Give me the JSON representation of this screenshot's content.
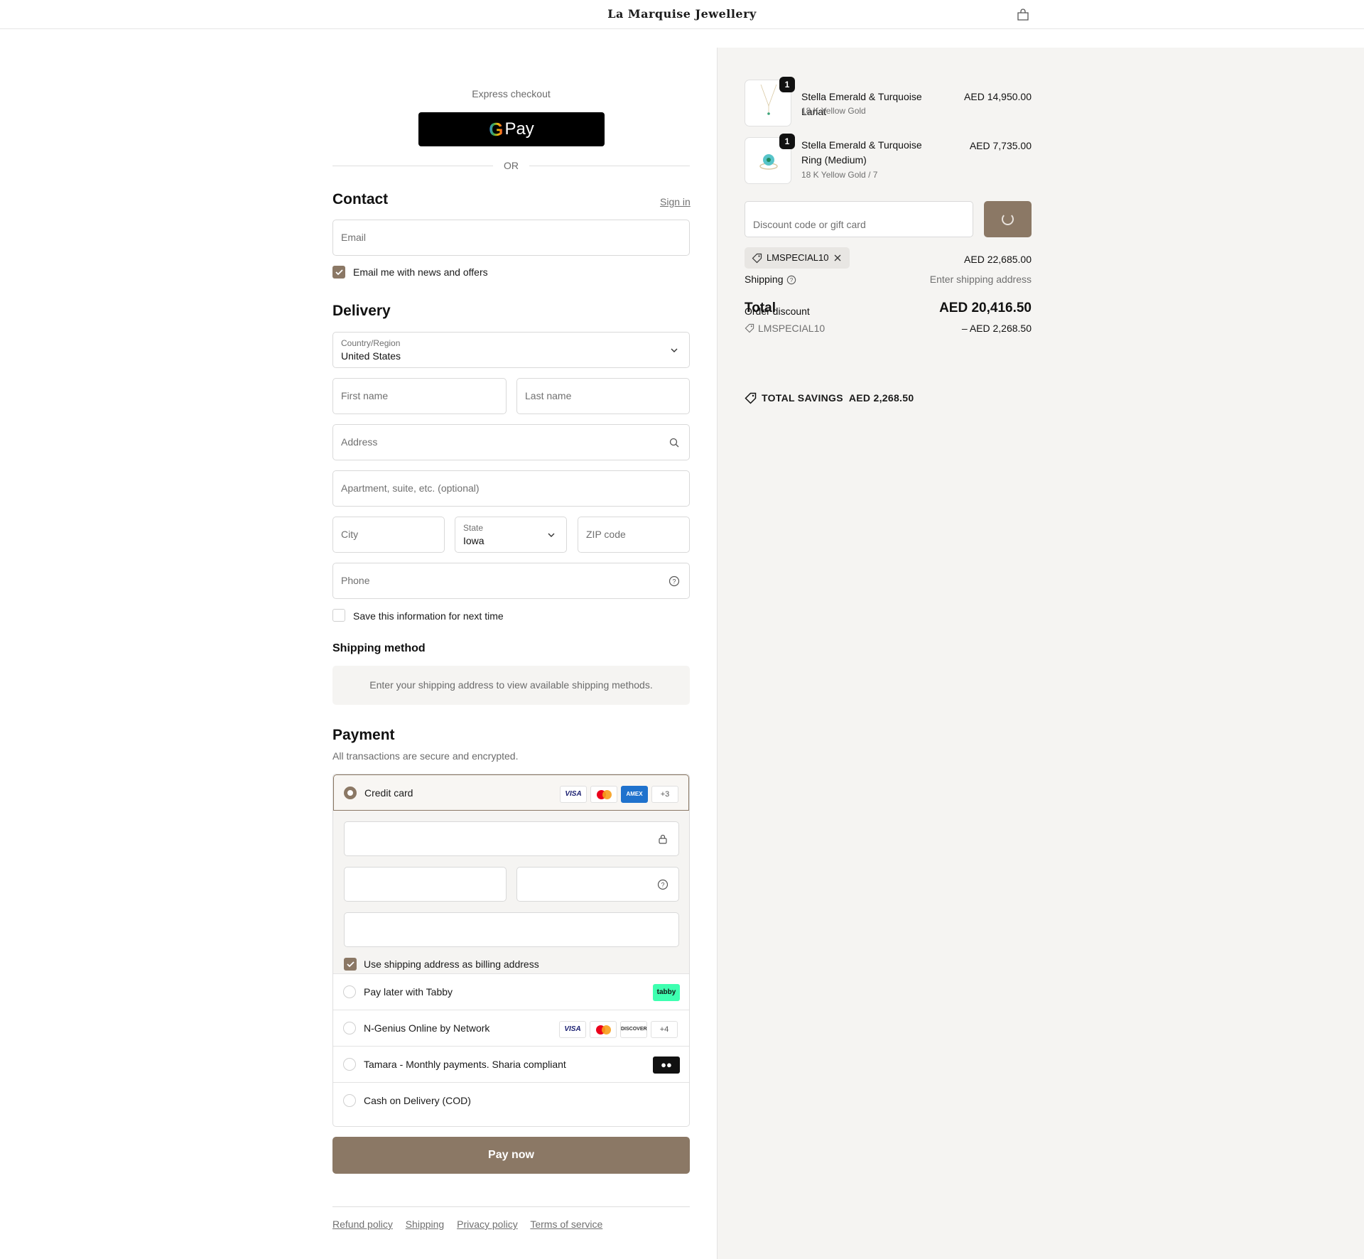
{
  "header": {
    "brand": "La Marquise Jewellery",
    "cart_icon": "shopping-bag-icon"
  },
  "express": {
    "label": "Express checkout",
    "gpay_label": "Pay",
    "or": "OR"
  },
  "contact": {
    "title": "Contact",
    "sign_in": "Sign in",
    "email_placeholder": "Email",
    "news_label": "Email me with news and offers",
    "news_checked": true
  },
  "delivery": {
    "title": "Delivery",
    "country_label": "Country/Region",
    "country_value": "United States",
    "first_name": "First name",
    "last_name": "Last name",
    "address": "Address",
    "apartment": "Apartment, suite, etc. (optional)",
    "city": "City",
    "state_label": "State",
    "state_value": "Iowa",
    "zip": "ZIP code",
    "phone": "Phone",
    "save_label": "Save this information for next time",
    "save_checked": false
  },
  "shipping_method": {
    "title": "Shipping method",
    "message": "Enter your shipping address to view available shipping methods."
  },
  "payment": {
    "title": "Payment",
    "subtitle": "All transactions are secure and encrypted.",
    "credit_card_label": "Credit card",
    "cc_logos": [
      "VISA",
      "AMEX",
      "+3"
    ],
    "billing_label": "Use shipping address as billing address",
    "billing_checked": true,
    "options": [
      {
        "label": "Pay later with Tabby",
        "badge": "tabby"
      },
      {
        "label": "N-Genius Online by Network",
        "logos": [
          "VISA",
          "DISCOVER",
          "+4"
        ]
      },
      {
        "label": "Tamara - Monthly payments. Sharia compliant"
      },
      {
        "label": "Cash on Delivery (COD)"
      }
    ],
    "pay_now": "Pay now"
  },
  "footer": {
    "links": [
      "Refund policy",
      "Shipping",
      "Privacy policy",
      "Terms of service"
    ]
  },
  "summary": {
    "items": [
      {
        "qty": "1",
        "name": "Stella Emerald & Turquoise Lariat",
        "variant": "18 K Yellow Gold",
        "price": "AED 14,950.00"
      },
      {
        "qty": "1",
        "name": "Stella Emerald & Turquoise Ring (Medium)",
        "variant": "18 K Yellow Gold / 7",
        "price": "AED 7,735.00"
      }
    ],
    "discount_placeholder": "Discount code or gift card",
    "applied_code": "LMSPECIAL10",
    "subtotal": "AED 22,685.00",
    "shipping_label": "Shipping",
    "shipping_value": "Enter shipping address",
    "total_label": "Total",
    "total_value": "AED 20,416.50",
    "order_discount_label": "Order discount",
    "order_discount_code": "LMSPECIAL10",
    "order_discount_value": "– AED 2,268.50",
    "savings_label": "TOTAL SAVINGS",
    "savings_value": "AED 2,268.50"
  },
  "colors": {
    "accent": "#8b7865",
    "summary_bg": "#f5f4f2"
  }
}
